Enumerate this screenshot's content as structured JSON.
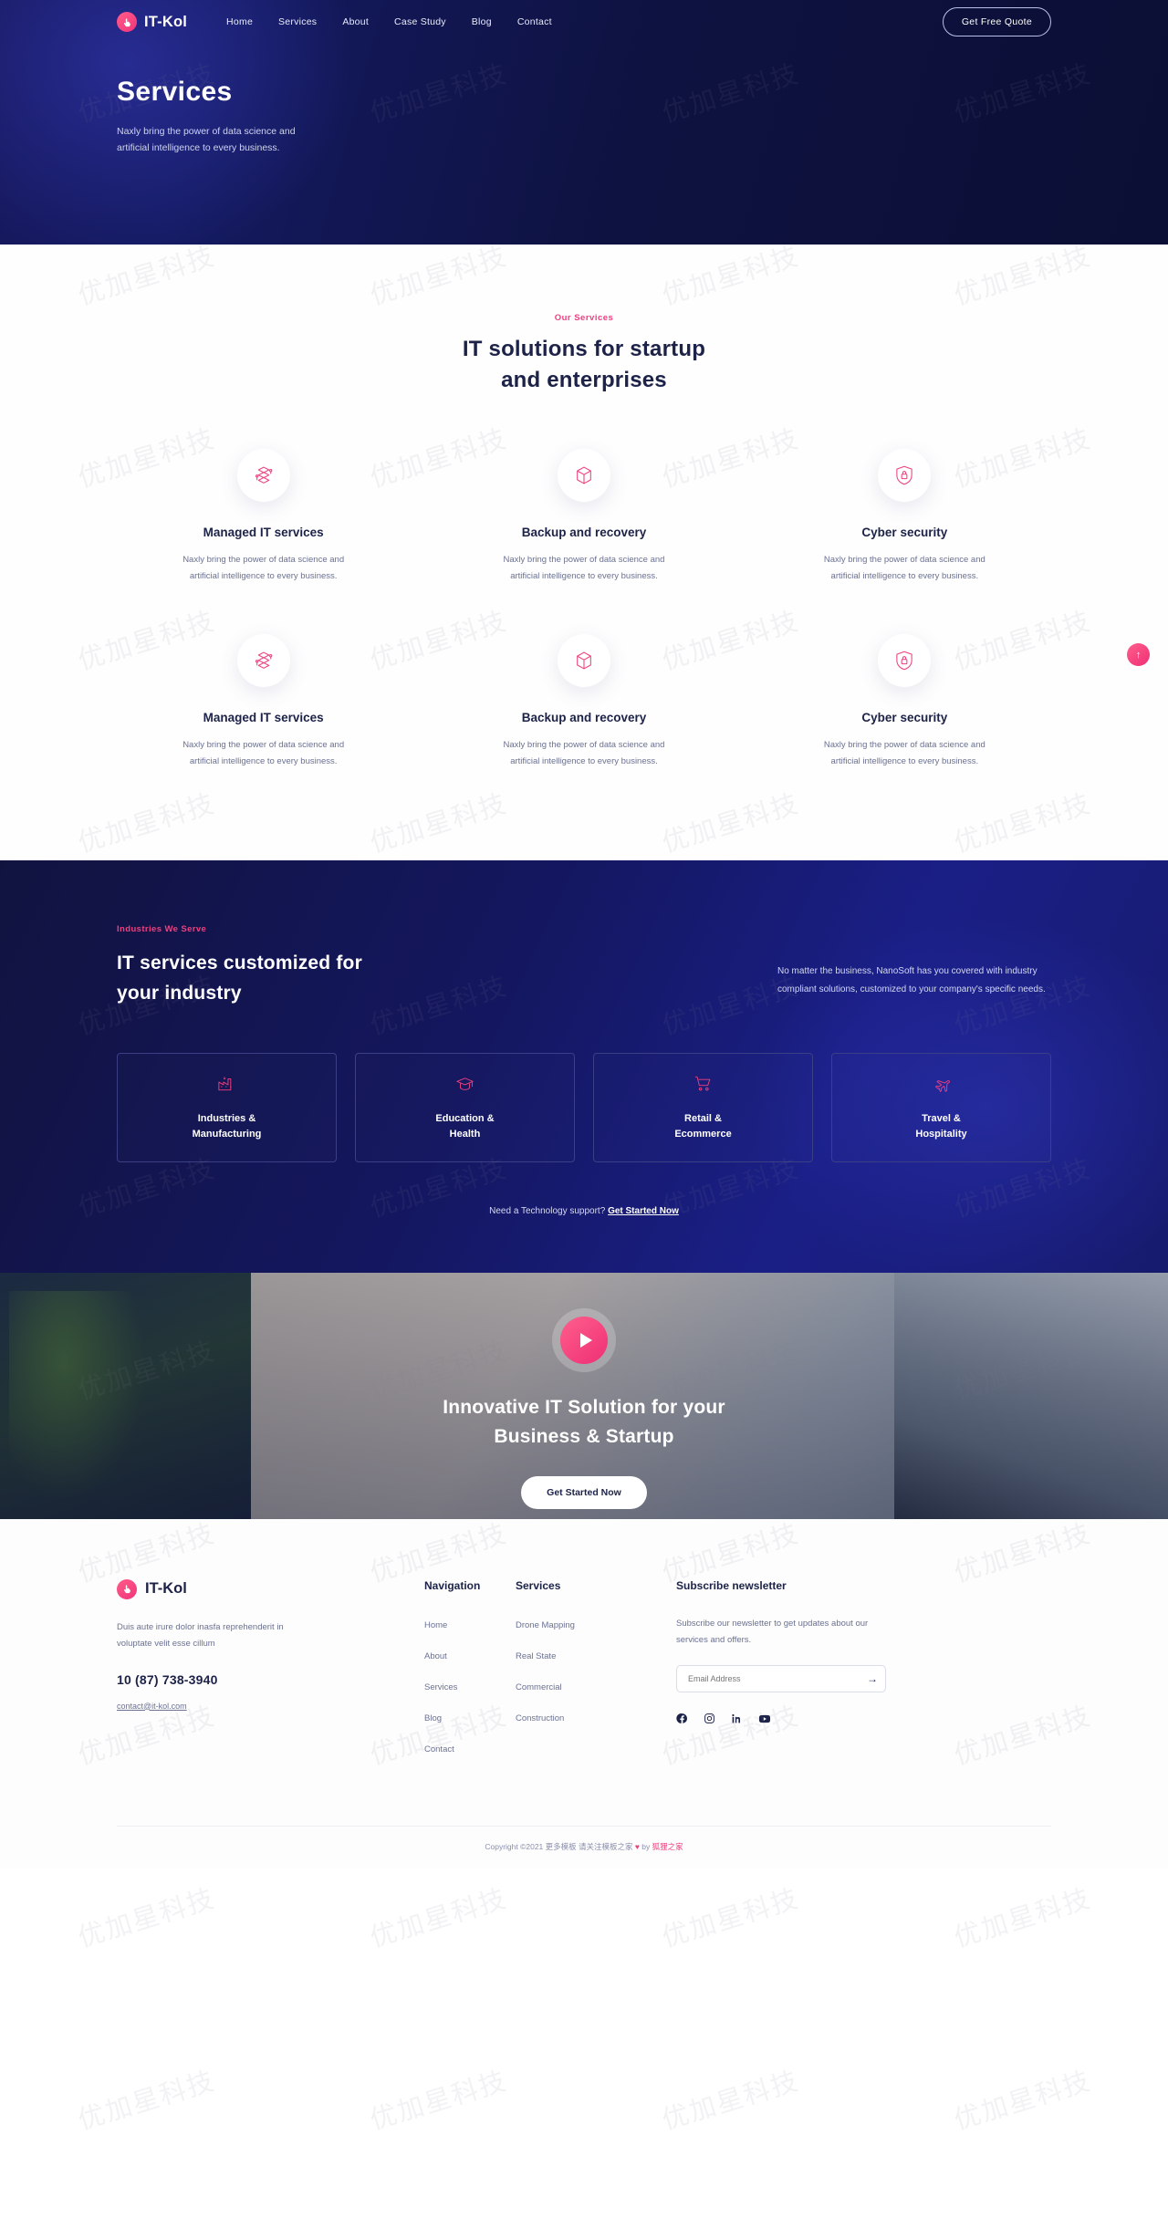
{
  "header": {
    "brand": "IT-Kol",
    "brand_icon": "hand-pointer-icon",
    "nav": [
      {
        "label": "Home"
      },
      {
        "label": "Services"
      },
      {
        "label": "About"
      },
      {
        "label": "Case Study"
      },
      {
        "label": "Blog"
      },
      {
        "label": "Contact"
      }
    ],
    "cta": "Get Free Quote"
  },
  "hero": {
    "title": "Services",
    "subtitle": "Naxly bring the power of data science and artificial intelligence to every business."
  },
  "services": {
    "eyebrow": "Our Services",
    "title_line1": "IT solutions for startup",
    "title_line2": "and enterprises",
    "cards": [
      {
        "icon": "server-stack-icon",
        "name": "Managed IT services",
        "desc": "Naxly bring the power of data science and artificial intelligence to every business."
      },
      {
        "icon": "box-cube-icon",
        "name": "Backup and recovery",
        "desc": "Naxly bring the power of data science and artificial intelligence to every business."
      },
      {
        "icon": "shield-lock-icon",
        "name": "Cyber security",
        "desc": "Naxly bring the power of data science and artificial intelligence to every business."
      },
      {
        "icon": "server-stack-icon",
        "name": "Managed IT services",
        "desc": "Naxly bring the power of data science and artificial intelligence to every business."
      },
      {
        "icon": "box-cube-icon",
        "name": "Backup and recovery",
        "desc": "Naxly bring the power of data science and artificial intelligence to every business."
      },
      {
        "icon": "shield-lock-icon",
        "name": "Cyber security",
        "desc": "Naxly bring the power of data science and artificial intelligence to every business."
      }
    ]
  },
  "industries": {
    "eyebrow": "Industries We Serve",
    "title": "IT services customized for your industry",
    "paragraph": "No matter the business, NanoSoft has you covered with industry compliant solutions, customized to your company's specific needs.",
    "cards": [
      {
        "icon": "factory-icon",
        "line1": "Industries &",
        "line2": "Manufacturing"
      },
      {
        "icon": "graduation-cap-icon",
        "line1": "Education &",
        "line2": "Health"
      },
      {
        "icon": "shopping-cart-icon",
        "line1": "Retail &",
        "line2": "Ecommerce"
      },
      {
        "icon": "airplane-icon",
        "line1": "Travel &",
        "line2": "Hospitality"
      }
    ],
    "footer_text": "Need a Technology support?",
    "footer_link": "Get Started Now"
  },
  "banner": {
    "play_icon": "play-icon",
    "title_line1": "Innovative IT Solution for your",
    "title_line2": "Business & Startup",
    "cta": "Get Started Now"
  },
  "footer": {
    "brand": "IT-Kol",
    "brand_icon": "hand-pointer-icon",
    "description": "Duis aute irure dolor inasfa reprehenderit in voluptate velit esse cillum",
    "phone": "10 (87) 738-3940",
    "email": "contact@it-kol.com",
    "nav_heading": "Navigation",
    "nav_links": [
      "Home",
      "About",
      "Services",
      "Blog",
      "Contact"
    ],
    "services_heading": "Services",
    "services_links": [
      "Drone Mapping",
      "Real State",
      "Commercial",
      "Construction"
    ],
    "subscribe_heading": "Subscribe newsletter",
    "subscribe_desc": "Subscribe our newsletter to get updates about our services and offers.",
    "email_placeholder": "Email Address",
    "email_value": "",
    "submit_icon": "arrow-right-icon",
    "social": [
      {
        "icon": "facebook-icon"
      },
      {
        "icon": "instagram-icon"
      },
      {
        "icon": "linkedin-icon"
      },
      {
        "icon": "youtube-icon"
      }
    ],
    "copyright_pre": "Copyright ©2021 ",
    "copyright_mid": "更多模板 请关注模板之家 ",
    "copyright_by": " by ",
    "copyright_link": "狐狸之家"
  },
  "scroll_top_icon": "arrow-up-icon",
  "watermark_text": "优加星科技",
  "colors": {
    "accent": "#ef3f7e",
    "dark": "#1c2248",
    "hero_bg": "#0e1240",
    "muted": "#6b7192"
  }
}
